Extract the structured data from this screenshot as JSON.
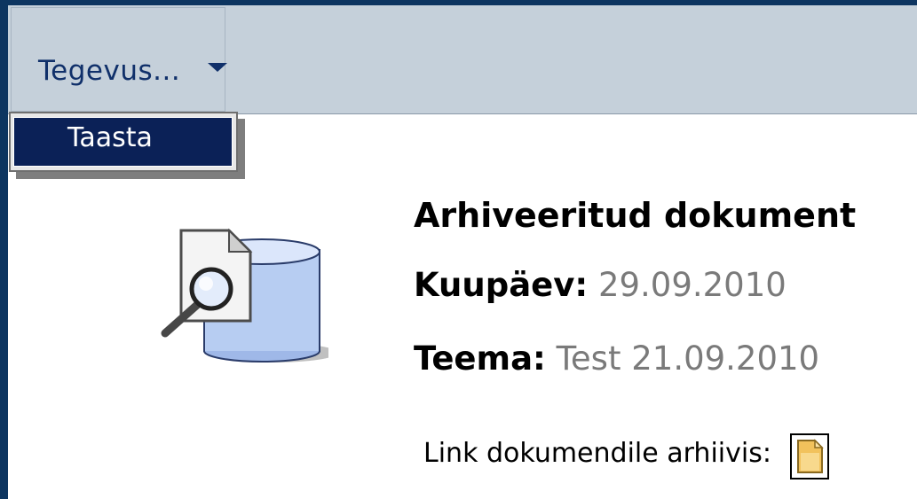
{
  "toolbar": {
    "menu_label": "Tegevus...",
    "menu_items": [
      {
        "label": "Taasta"
      }
    ]
  },
  "document": {
    "heading": "Arhiveeritud dokument",
    "date_label": "Kuupäev:",
    "date_value": "29.09.2010",
    "topic_label": "Teema:",
    "topic_value": "Test 21.09.2010",
    "link_label": "Link dokumendile arhiivis:"
  },
  "icons": {
    "archive": "archive-search-icon",
    "document_link": "document-icon"
  },
  "colors": {
    "border": "#0d3560",
    "toolbar": "#c5d0da",
    "menu_text": "#10306a",
    "highlight": "#0b2157",
    "value_text": "#7a7a7a"
  }
}
